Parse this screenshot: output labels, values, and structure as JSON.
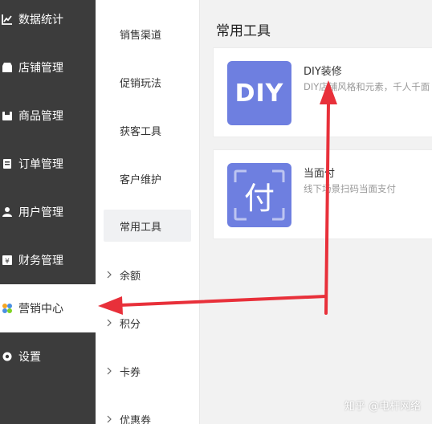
{
  "sidebar": {
    "items": [
      {
        "label": "数据统计",
        "icon": "chart-icon"
      },
      {
        "label": "店铺管理",
        "icon": "store-icon"
      },
      {
        "label": "商品管理",
        "icon": "box-icon"
      },
      {
        "label": "订单管理",
        "icon": "order-icon"
      },
      {
        "label": "用户管理",
        "icon": "user-icon"
      },
      {
        "label": "财务管理",
        "icon": "finance-icon"
      },
      {
        "label": "营销中心",
        "icon": "marketing-icon"
      },
      {
        "label": "设置",
        "icon": "settings-icon"
      }
    ],
    "active_index": 6
  },
  "submenu": {
    "items": [
      "销售渠道",
      "促销玩法",
      "获客工具",
      "客户维护",
      "常用工具"
    ],
    "active": "常用工具",
    "groups": [
      "余额",
      "积分",
      "卡券",
      "优惠券"
    ]
  },
  "main": {
    "section_title": "常用工具",
    "cards": [
      {
        "icon_text": "DIY",
        "title": "DIY装修",
        "desc": "DIY店铺风格和元素，千人千面"
      },
      {
        "icon_text": "付",
        "title": "当面付",
        "desc": "线下场景扫码当面支付"
      }
    ]
  },
  "watermark": "知乎 @电杆网络",
  "colors": {
    "sidebar_bg": "#3c3c3c",
    "card_icon_bg": "#6e7fe0",
    "arrow": "#e8303a"
  }
}
